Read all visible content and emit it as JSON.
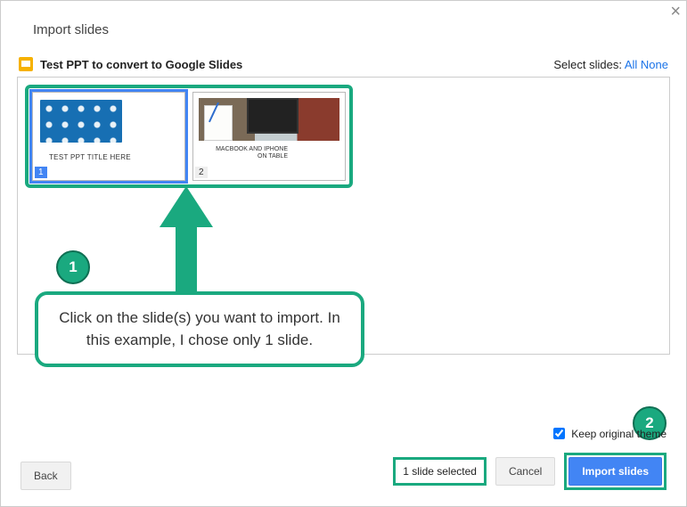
{
  "dialog": {
    "title": "Import slides",
    "close_glyph": "×"
  },
  "file": {
    "name": "Test PPT to convert to Google Slides"
  },
  "select_slides": {
    "label": "Select slides:",
    "all": "All",
    "none": "None"
  },
  "slides": [
    {
      "num": "1",
      "caption": "TEST PPT TITLE HERE",
      "selected": true
    },
    {
      "num": "2",
      "caption": "MACBOOK AND IPHONE ON TABLE",
      "selected": false
    }
  ],
  "annotation": {
    "badge1": "1",
    "badge2": "2",
    "text": "Click on the slide(s) you want to import. In this example, I chose only 1 slide."
  },
  "footer": {
    "back": "Back",
    "selected_count": "1 slide selected",
    "cancel": "Cancel",
    "import": "Import slides",
    "keep_theme": "Keep original theme",
    "keep_theme_checked": true
  }
}
